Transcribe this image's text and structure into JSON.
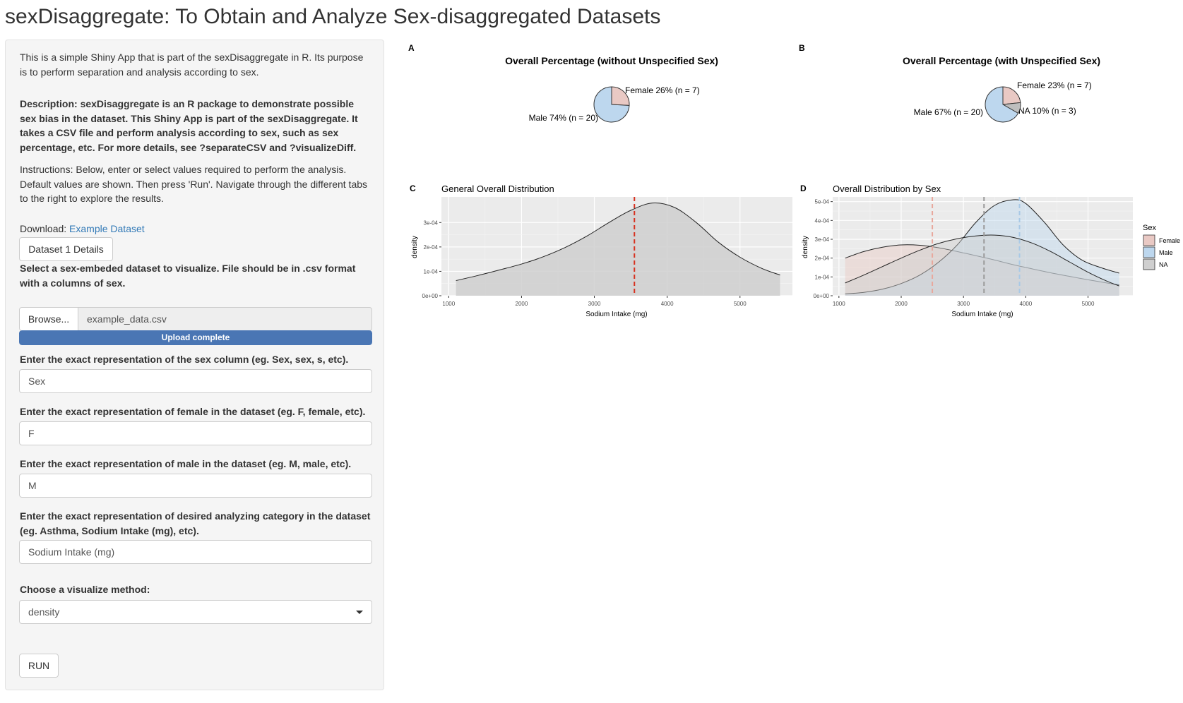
{
  "app_title": "sexDisaggregate: To Obtain and Analyze Sex-disaggregated Datasets",
  "sidebar": {
    "intro": "This is a simple Shiny App that is part of the sexDisaggregate in R. Its purpose is to perform separation and analysis according to sex.",
    "description": "Description: sexDisaggregate is an R package to demonstrate possible sex bias in the dataset. This Shiny App is part of the sexDisaggregate. It takes a CSV file and perform analysis according to sex, such as sex percentage, etc. For more details, see ?separateCSV and ?visualizeDiff.",
    "instructions": "Instructions: Below, enter or select values required to perform the analysis. Default values are shown. Then press 'Run'. Navigate through the different tabs to the right to explore the results.",
    "download_prefix": "Download: ",
    "download_link": "Example Dataset",
    "dataset_details_button": "Dataset 1 Details",
    "file_label": "Select a sex-embeded dataset to visualize. File should be in .csv format with a columns of sex.",
    "browse_button": "Browse...",
    "file_name": "example_data.csv",
    "upload_status": "Upload complete",
    "upload_progress": 1.0,
    "sex_column_label": "Enter the exact representation of the sex column (eg. Sex, sex, s, etc).",
    "sex_column_value": "Sex",
    "female_label": "Enter the exact representation of female in the dataset (eg. F, female, etc).",
    "female_value": "F",
    "male_label": "Enter the exact representation of male in the dataset (eg. M, male, etc).",
    "male_value": "M",
    "category_label": "Enter the exact representation of desired analyzing category in the dataset (eg. Asthma, Sodium Intake (mg), etc).",
    "category_value": "Sodium Intake (mg)",
    "method_label": "Choose a visualize method:",
    "method_value": "density",
    "run_button": "RUN"
  },
  "colors": {
    "female": "#e9c9c4",
    "male": "#bdd7ee",
    "na": "#cfcfcf",
    "panel_bg": "#ebebeb",
    "mean_line_overall": "#d7301f",
    "progress": "#4a76b4"
  },
  "chart_data": [
    {
      "panel": "A",
      "type": "pie",
      "title": "Overall Percentage (without Unspecified Sex)",
      "slices": [
        {
          "label": "Female 26% (n = 7)",
          "value": 7,
          "color": "#e9c9c4"
        },
        {
          "label": "Male 74% (n = 20)",
          "value": 20,
          "color": "#bdd7ee"
        }
      ]
    },
    {
      "panel": "B",
      "type": "pie",
      "title": "Overall Percentage (with Unspecified Sex)",
      "slices": [
        {
          "label": "Female 23% (n = 7)",
          "value": 7,
          "color": "#e9c9c4"
        },
        {
          "label": "NA 10% (n = 3)",
          "value": 3,
          "color": "#bebebe"
        },
        {
          "label": "Male 67% (n = 20)",
          "value": 20,
          "color": "#bdd7ee"
        }
      ]
    },
    {
      "panel": "C",
      "type": "area",
      "title": "General Overall Distribution",
      "xlabel": "Sodium Intake (mg)",
      "ylabel": "density",
      "xlim": [
        900,
        5720
      ],
      "ylim": [
        0,
        4.05e-05
      ],
      "xticks": [
        "1000",
        "2000",
        "3000",
        "4000",
        "5000"
      ],
      "yticks": [
        "0e+00",
        "1e-04",
        "2e-04",
        "3e-04"
      ],
      "mean_line": 3550,
      "series": [
        {
          "x": [
            1100,
            1400,
            1700,
            2000,
            2300,
            2600,
            2900,
            3200,
            3500,
            3800,
            4100,
            4400,
            4700,
            5000,
            5300,
            5550
          ],
          "y": [
            6.2e-06,
            8.3e-06,
            1.06e-05,
            1.3e-05,
            1.6e-05,
            1.98e-05,
            2.45e-05,
            3e-05,
            3.5e-05,
            3.8e-05,
            3.62e-05,
            3e-05,
            2.2e-05,
            1.58e-05,
            1.12e-05,
            8.5e-06
          ],
          "color": "#cfcfcf"
        }
      ]
    },
    {
      "panel": "D",
      "type": "area",
      "title": "Overall Distribution by Sex",
      "xlabel": "Sodium Intake (mg)",
      "ylabel": "density",
      "xlim": [
        900,
        5720
      ],
      "ylim": [
        0,
        5.25e-05
      ],
      "xticks": [
        "1000",
        "2000",
        "3000",
        "4000",
        "5000"
      ],
      "yticks": [
        "0e+00",
        "1e-04",
        "2e-04",
        "3e-04",
        "4e-04",
        "5e-04"
      ],
      "legend_title": "Sex",
      "legend_position": "right",
      "series": [
        {
          "name": "Female",
          "color": "#e9c9c4",
          "mean_line": 2500,
          "x": [
            1100,
            1400,
            1700,
            2000,
            2300,
            2600,
            2900,
            3200,
            3500,
            3800,
            4100,
            4400,
            4700,
            5000,
            5300,
            5500
          ],
          "y": [
            2e-05,
            2.35e-05,
            2.58e-05,
            2.7e-05,
            2.68e-05,
            2.55e-05,
            2.35e-05,
            2.13e-05,
            1.9e-05,
            1.65e-05,
            1.43e-05,
            1.22e-05,
            1.03e-05,
            8.5e-06,
            6.8e-06,
            5.8e-06
          ]
        },
        {
          "name": "Male",
          "color": "#bdd7ee",
          "mean_line": 3900,
          "x": [
            1100,
            1400,
            1700,
            2000,
            2300,
            2600,
            2900,
            3200,
            3500,
            3800,
            4000,
            4300,
            4600,
            4900,
            5200,
            5500
          ],
          "y": [
            1e-06,
            1.8e-06,
            3.5e-06,
            6.5e-06,
            1.1e-05,
            1.78e-05,
            2.7e-05,
            3.9e-05,
            4.8e-05,
            5.1e-05,
            4.9e-05,
            3.9e-05,
            2.7e-05,
            1.9e-05,
            1.5e-05,
            1.2e-05
          ]
        },
        {
          "name": "NA",
          "color": "#cfcfcf",
          "mean_line": 3330,
          "x": [
            1100,
            1400,
            1700,
            2000,
            2300,
            2600,
            2900,
            3200,
            3500,
            3800,
            4100,
            4400,
            4700,
            5000,
            5300,
            5500
          ],
          "y": [
            6.8e-06,
            1.1e-05,
            1.55e-05,
            2e-05,
            2.42e-05,
            2.78e-05,
            3.03e-05,
            3.18e-05,
            3.22e-05,
            3.1e-05,
            2.8e-05,
            2.35e-05,
            1.8e-05,
            1.25e-05,
            7.8e-06,
            5.2e-06
          ]
        }
      ]
    }
  ],
  "panel_letters": [
    "A",
    "B",
    "C",
    "D"
  ]
}
